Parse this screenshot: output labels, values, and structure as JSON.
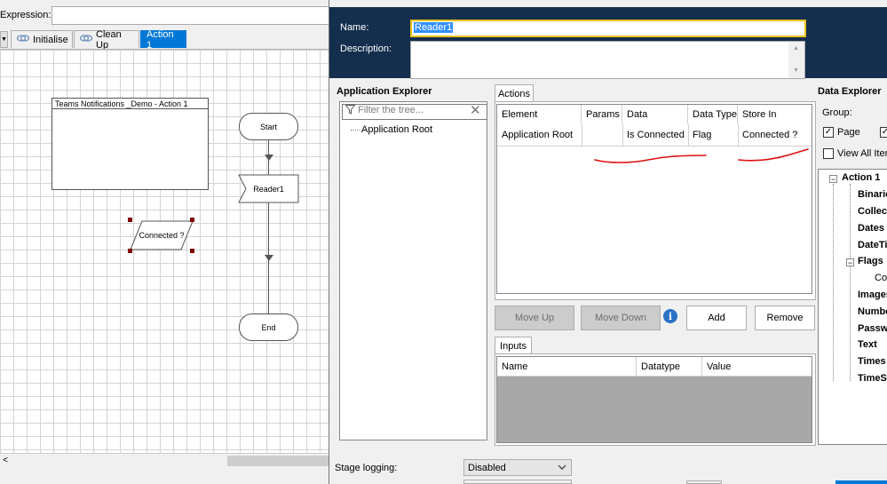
{
  "left": {
    "expression_label": "Expression:",
    "tabs": [
      {
        "label": "Initialise",
        "icon": "page-icon"
      },
      {
        "label": "Clean Up",
        "icon": "page-icon"
      },
      {
        "label": "Action 1"
      }
    ],
    "canvas": {
      "page_box_title": "Teams Notifications _Demo - Action 1",
      "start_label": "Start",
      "reader_label": "Reader1",
      "data_item_label": "Connected ?",
      "end_label": "End"
    },
    "scroll_left": "<"
  },
  "dialog": {
    "name_label": "Name:",
    "name_value": "Reader1",
    "description_label": "Description:",
    "description_value": "",
    "app_explorer": {
      "title": "Application Explorer",
      "filter_placeholder": "Filter the tree...",
      "root_item": "Application Root"
    },
    "actions": {
      "tab_label": "Actions",
      "columns": [
        "Element",
        "Params",
        "Data",
        "Data Type",
        "Store In"
      ],
      "rows": [
        {
          "element": "Application Root",
          "params": "",
          "data": "Is Connected",
          "data_type": "Flag",
          "store_in": "Connected ?"
        }
      ]
    },
    "buttons": {
      "move_up": "Move Up",
      "move_down": "Move Down",
      "add": "Add",
      "remove": "Remove"
    },
    "inputs": {
      "tab_label": "Inputs",
      "columns": [
        "Name",
        "Datatype",
        "Value"
      ]
    },
    "data_explorer": {
      "title": "Data Explorer",
      "group_label": "Group:",
      "page_checkbox": "Page",
      "page_checked": true,
      "second_checked": true,
      "view_all_label": "View All Item",
      "tree": [
        {
          "label": "Action 1",
          "level": 0,
          "expander": "−"
        },
        {
          "label": "Binarie",
          "level": 1
        },
        {
          "label": "Collecti",
          "level": 1
        },
        {
          "label": "Dates",
          "level": 1
        },
        {
          "label": "DateTim",
          "level": 1
        },
        {
          "label": "Flags",
          "level": 1,
          "expander": "−"
        },
        {
          "label": "Con",
          "level": 2
        },
        {
          "label": "Images",
          "level": 1
        },
        {
          "label": "Numbe",
          "level": 1
        },
        {
          "label": "Passwo",
          "level": 1
        },
        {
          "label": "Text",
          "level": 1
        },
        {
          "label": "Times",
          "level": 1
        },
        {
          "label": "TimeSp",
          "level": 1
        }
      ]
    },
    "stage_logging_label": "Stage logging:",
    "stage_logging_value": "Disabled",
    "colors": {
      "header_bg": "#142f4d",
      "name_border": "#e8c01c",
      "selection": "#3390ff",
      "active_tab": "#0078d7",
      "annotation_red": "#e01010"
    }
  }
}
